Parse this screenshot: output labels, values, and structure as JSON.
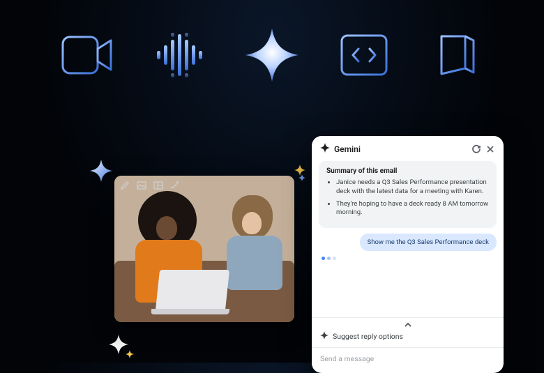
{
  "gemini_panel": {
    "title": "Gemini",
    "summary": {
      "heading": "Summary of this email",
      "bullets": [
        "Janice needs a Q3 Sales Performance presentation deck with the latest data for a meeting with Karen.",
        "They're hoping to have a deck ready 8 AM tomorrow morning."
      ]
    },
    "reply_chip": "Show me the Q3 Sales Performance deck",
    "suggest_label": "Suggest reply options",
    "input_placeholder": "Send a message"
  },
  "top_icons": [
    "video-camera-icon",
    "audio-waveform-icon",
    "gemini-spark-icon",
    "code-brackets-icon",
    "notebook-icon"
  ],
  "image_toolbar_icons": [
    "pencil-icon",
    "image-icon",
    "layout-icon",
    "magic-wand-icon"
  ]
}
